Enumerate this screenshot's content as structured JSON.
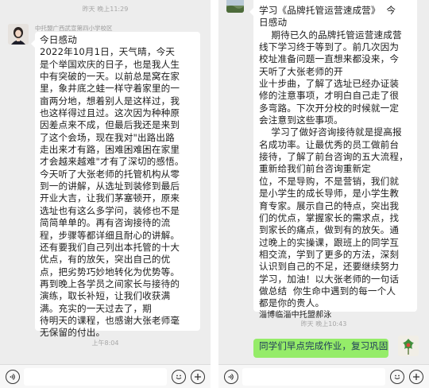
{
  "left": {
    "timestamp_top": "昨天 晚上11:29",
    "sender_name": "中托盟广西武宣第四小学校区",
    "message_lines": [
      "今日感动",
      "2022年10月1日，天气晴，今天",
      "是个举国欢庆的日子，也是我人生",
      "中有突破的一天。以前总是窝在家",
      "里，象井底之蛙一样守着家里的一",
      "亩两分地，想着别人是这样过，我",
      "也这样得过且过。这次因为种种原",
      "因差点来不成，但最后我还是来到",
      "了这个会场，现在我对\"出路出路",
      "走出来才有路，困难困难困在家里",
      "才会越来越难\"才有了深切的感悟。",
      "今天听了大张老师的托管机构从零",
      "到一的讲解，从选址到装修到最后",
      "开业大吉，让我们茅塞顿开，原来",
      "选址也有这么多学问，装修也不是",
      "简简单单的。再有咨询接待的流",
      "程，步骤等都详细且耐心的讲解。",
      "还有要我们自己列出本托管的十大",
      "优点，有的放矢，突出自己的优",
      "点，把劣势巧妙地转化为优势等。",
      "再到晚上各学员之间家长与接待的",
      "演练，取长补短，让我们收获满",
      "满。充实的一天过去了，期",
      "待明天的课程，也感谢大张老师毫",
      "无保留的付出。"
    ],
    "timestamp_bottom": "上午8:04"
  },
  "right": {
    "message_lines": [
      "学习《品牌托管运营速成营》  今",
      "日感动",
      "    期待已久的品牌托管运营速成营",
      "线下学习终于等到了。前几次因为",
      "校址准备问题一直想来都没来，今",
      "天听了大张老师的开",
      "业十步曲，了解了选址已经办证装",
      "修的注意事项，才明白自己走了很",
      "多弯路。下次开分校的时候就一定",
      "会注意到这些事项。",
      "    学习了做好咨询接待就是提高报",
      "名成功率。让最优秀的员工做前台",
      "接待，了解了前台咨询的五大流程，",
      "重新给我们前台咨询重新定",
      "位，不是导购，不是营销，我们就",
      "是小学生的成长导师，是小学生教",
      "育专家。展示自己的特点，突出我",
      "们的优点，掌握家长的需求点，找",
      "到家长的痛点，做到有的放矢。通",
      "过晚上的实操课，跟班上的同学互",
      "相交流，学到了更多的方法，深刻",
      "认识到自己的不足，还要继续努力",
      "学习，加油！以大张老师的一句话",
      "做总结  你生命中遇到的每一个人",
      "都是你的贵人。"
    ],
    "signature": "淄博临淄中托盟郝泳",
    "timestamp_bottom": "昨天 晚上10:43",
    "green_message": "同学们早点完成作业，复习巩固"
  },
  "toolbar": {
    "voice_icon": "voice-icon",
    "emoji_icon": "emoji-icon",
    "plus_icon": "plus-icon"
  },
  "colors": {
    "background": "#ededed",
    "bubble": "#ffffff",
    "self_bubble": "#95ec69"
  }
}
